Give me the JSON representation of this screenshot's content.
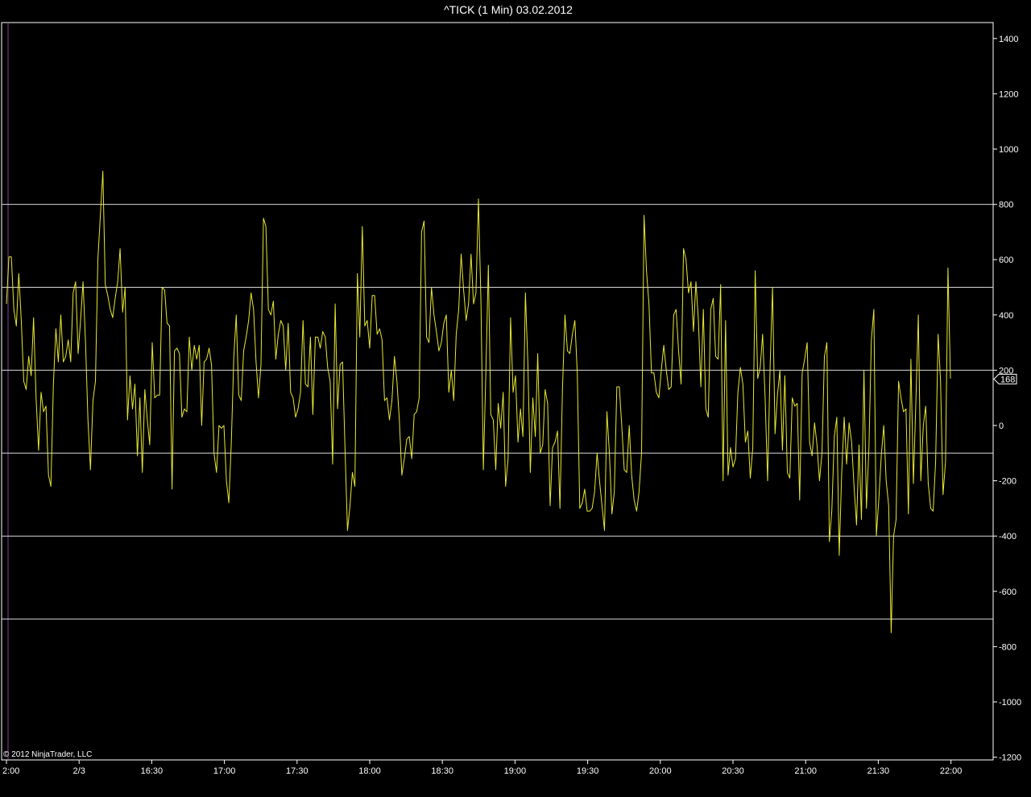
{
  "colors": {
    "background": "#000000",
    "series": "#e8e832",
    "hlines": "#d8d8d8",
    "axis": "#ffffff",
    "left_marker": "#5a2a6a"
  },
  "copyright": "© 2012 NinjaTrader, LLC",
  "chart_data": {
    "type": "line",
    "title": "^TICK (1 Min)  03.02.2012",
    "ylim": [
      -1200,
      1450
    ],
    "y_ticks": [
      1400,
      1200,
      1000,
      800,
      600,
      400,
      200,
      0,
      -200,
      -400,
      -600,
      -800,
      -1000,
      -1200
    ],
    "y_tick_labels": [
      "1400",
      "1200",
      "1000",
      "800",
      "600",
      "400",
      "200",
      "0",
      "-200",
      "-400",
      "-600",
      "-800",
      "-1000",
      "-1200"
    ],
    "x_tick_labels": [
      "2:00",
      "2/3",
      "16:30",
      "17:00",
      "17:30",
      "18:00",
      "18:30",
      "19:00",
      "19:30",
      "20:00",
      "20:30",
      "21:00",
      "21:30",
      "22:00"
    ],
    "horizontal_lines": [
      800,
      500,
      200,
      -100,
      -400,
      -700
    ],
    "last_value": 168,
    "last_value_label": "168",
    "grid": false,
    "series": [
      {
        "values": [
          440,
          610,
          610,
          420,
          360,
          550,
          380,
          160,
          130,
          250,
          180,
          390,
          100,
          -90,
          120,
          50,
          70,
          -180,
          -220,
          150,
          350,
          230,
          400,
          230,
          250,
          310,
          230,
          480,
          520,
          260,
          380,
          520,
          300,
          20,
          -160,
          90,
          160,
          600,
          760,
          920,
          510,
          470,
          420,
          390,
          460,
          520,
          640,
          410,
          500,
          20,
          180,
          60,
          150,
          -110,
          100,
          -170,
          130,
          20,
          -70,
          300,
          100,
          110,
          110,
          500,
          490,
          370,
          360,
          -230,
          270,
          280,
          260,
          30,
          60,
          50,
          320,
          200,
          290,
          240,
          290,
          0,
          230,
          240,
          280,
          220,
          -100,
          -170,
          0,
          -10,
          0,
          -200,
          -280,
          -60,
          250,
          400,
          110,
          90,
          270,
          320,
          380,
          480,
          420,
          230,
          100,
          220,
          750,
          720,
          420,
          400,
          450,
          240,
          330,
          380,
          360,
          200,
          370,
          120,
          100,
          30,
          60,
          120,
          380,
          150,
          140,
          320,
          40,
          320,
          320,
          280,
          340,
          320,
          210,
          160,
          -140,
          440,
          60,
          220,
          230,
          -80,
          -380,
          -290,
          -170,
          -220,
          550,
          320,
          720,
          360,
          380,
          280,
          470,
          470,
          330,
          350,
          310,
          90,
          100,
          20,
          90,
          250,
          160,
          20,
          -180,
          -120,
          -50,
          -40,
          -120,
          40,
          50,
          100,
          700,
          740,
          320,
          300,
          500,
          400,
          340,
          270,
          300,
          370,
          400,
          120,
          200,
          90,
          330,
          420,
          620,
          490,
          380,
          440,
          620,
          440,
          480,
          820,
          450,
          -160,
          190,
          580,
          40,
          20,
          -160,
          80,
          -10,
          120,
          -220,
          -120,
          390,
          120,
          180,
          -60,
          60,
          -40,
          480,
          220,
          -170,
          100,
          -40,
          260,
          -100,
          -70,
          130,
          80,
          -290,
          -80,
          -60,
          -20,
          -300,
          130,
          400,
          270,
          260,
          330,
          380,
          190,
          -300,
          -280,
          -230,
          -310,
          -310,
          -300,
          -240,
          -100,
          -200,
          -290,
          -380,
          50,
          -100,
          -320,
          -240,
          140,
          140,
          0,
          -160,
          -170,
          0,
          -180,
          -270,
          -310,
          -240,
          -100,
          760,
          560,
          440,
          190,
          190,
          120,
          100,
          200,
          290,
          200,
          130,
          140,
          400,
          420,
          270,
          150,
          640,
          600,
          480,
          520,
          340,
          520,
          380,
          140,
          420,
          60,
          30,
          420,
          460,
          250,
          240,
          510,
          -200,
          380,
          -180,
          -80,
          -150,
          -120,
          120,
          210,
          150,
          -60,
          -20,
          -190,
          -80,
          560,
          170,
          210,
          330,
          100,
          -200,
          200,
          500,
          -30,
          110,
          200,
          -90,
          180,
          -170,
          -190,
          100,
          70,
          80,
          -270,
          190,
          240,
          300,
          -60,
          -110,
          10,
          -70,
          -200,
          -100,
          250,
          300,
          -420,
          -310,
          -40,
          30,
          -470,
          -170,
          30,
          -140,
          10,
          -60,
          -220,
          -360,
          -70,
          -340,
          200,
          -300,
          -80,
          310,
          420,
          -400,
          -270,
          -110,
          0,
          -200,
          -290,
          -750,
          -400,
          -340,
          160,
          100,
          50,
          60,
          -320,
          240,
          -210,
          80,
          400,
          -200,
          0,
          70,
          -210,
          -300,
          -310,
          -130,
          330,
          160,
          -250,
          -130,
          570,
          170
        ]
      }
    ]
  }
}
